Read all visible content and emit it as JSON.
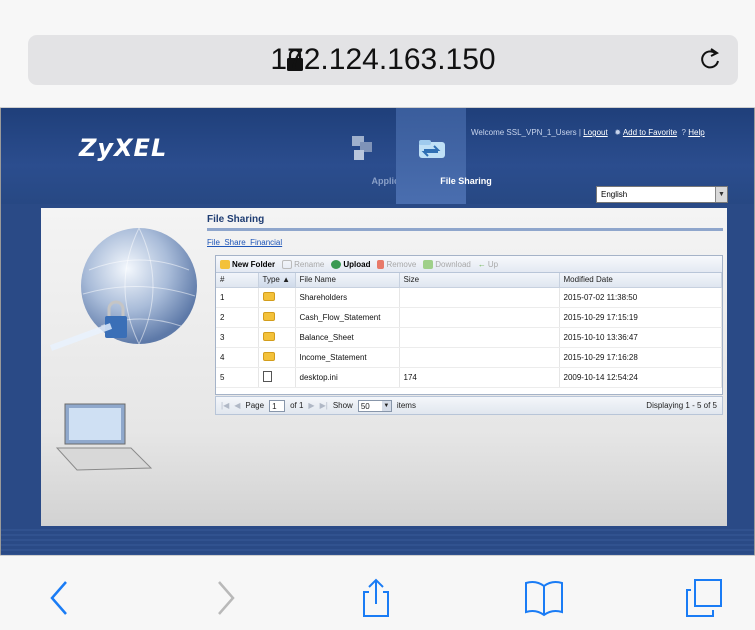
{
  "browser": {
    "url": "172.124.163.150",
    "icons": {
      "lock": "lock-icon",
      "reload": "reload-icon",
      "back": "back-icon",
      "forward": "forward-icon",
      "share": "share-icon",
      "bookmarks": "bookmarks-icon",
      "tabs": "tabs-icon"
    }
  },
  "header": {
    "logo": "ZyXEL",
    "tabs": [
      {
        "label": "Application",
        "icon": "application-icon"
      },
      {
        "label": "File Sharing",
        "icon": "file-sharing-icon"
      }
    ],
    "welcome": "Welcome SSL_VPN_1_Users |",
    "logout": "Logout",
    "add_favorite": "Add to Favorite",
    "help": "Help",
    "language": "English"
  },
  "file_sharing": {
    "title": "File Sharing",
    "breadcrumb": "File_Share_Financial",
    "toolbar": {
      "new_folder": "New Folder",
      "rename": "Rename",
      "upload": "Upload",
      "remove": "Remove",
      "download": "Download",
      "up": "Up"
    },
    "columns": [
      "#",
      "Type",
      "File Name",
      "Size",
      "Modified Date"
    ],
    "rows": [
      {
        "num": "1",
        "type": "folder",
        "name": "Shareholders",
        "size": "",
        "date": "2015-07-02 11:38:50"
      },
      {
        "num": "2",
        "type": "folder",
        "name": "Cash_Flow_Statement",
        "size": "",
        "date": "2015-10-29 17:15:19"
      },
      {
        "num": "3",
        "type": "folder",
        "name": "Balance_Sheet",
        "size": "",
        "date": "2015-10-10 13:36:47"
      },
      {
        "num": "4",
        "type": "folder",
        "name": "Income_Statement",
        "size": "",
        "date": "2015-10-29 17:16:28"
      },
      {
        "num": "5",
        "type": "file",
        "name": "desktop.ini",
        "size": "174",
        "date": "2009-10-14 12:54:24"
      }
    ],
    "pager": {
      "page_label": "Page",
      "page_value": "1",
      "of_label": "of 1",
      "show_label": "Show",
      "show_value": "50",
      "items_label": "items",
      "displaying": "Displaying 1 - 5 of 5"
    }
  },
  "colors": {
    "brand_blue": "#2a4a86",
    "link_blue": "#1f56b8",
    "folder": "#f3c13a"
  }
}
